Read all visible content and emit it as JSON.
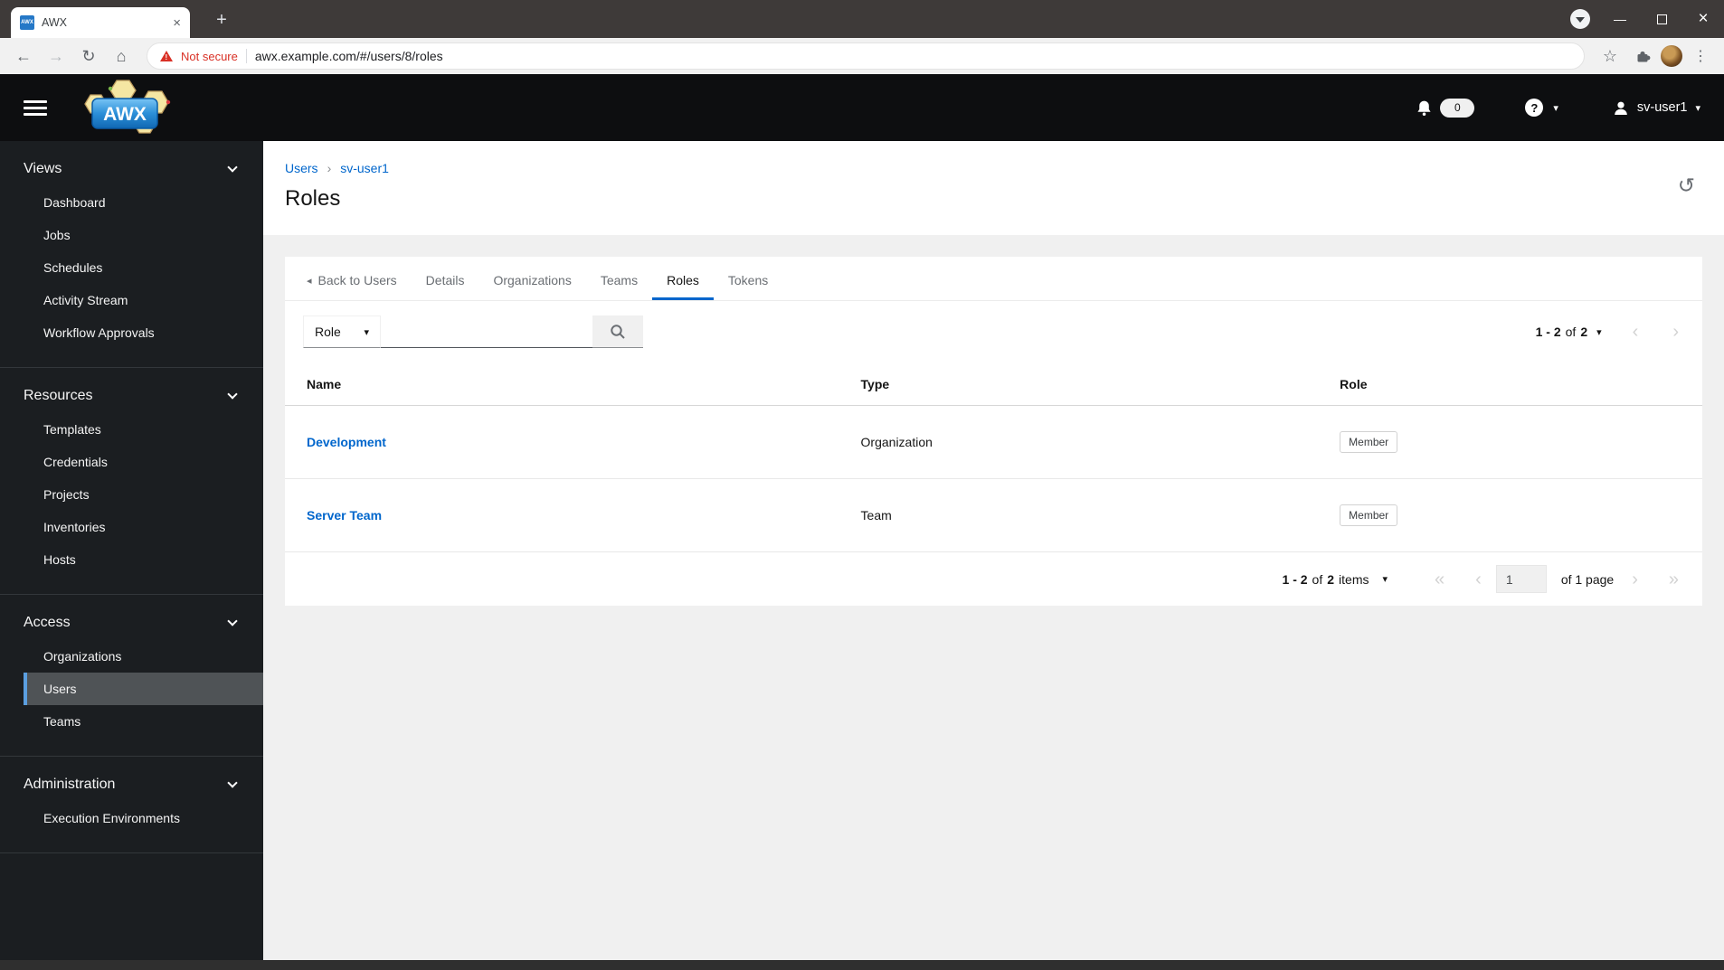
{
  "browser": {
    "tab_title": "AWX",
    "favicon_text": "AWX",
    "url": "awx.example.com/#/users/8/roles",
    "security_warning": "Not secure"
  },
  "app_header": {
    "logo_text": "AWX",
    "notification_count": "0",
    "help_glyph": "?",
    "username": "sv-user1"
  },
  "sidebar": {
    "active_item": "Users",
    "sections": [
      {
        "label": "Views",
        "items": [
          "Dashboard",
          "Jobs",
          "Schedules",
          "Activity Stream",
          "Workflow Approvals"
        ]
      },
      {
        "label": "Resources",
        "items": [
          "Templates",
          "Credentials",
          "Projects",
          "Inventories",
          "Hosts"
        ]
      },
      {
        "label": "Access",
        "items": [
          "Organizations",
          "Users",
          "Teams"
        ]
      },
      {
        "label": "Administration",
        "items": [
          "Execution Environments"
        ]
      }
    ]
  },
  "main": {
    "breadcrumb": {
      "items": [
        "Users",
        "sv-user1"
      ]
    },
    "page_title": "Roles",
    "tabs": {
      "back_label": "Back to Users",
      "labels": [
        "Details",
        "Organizations",
        "Teams",
        "Roles",
        "Tokens"
      ],
      "active": "Roles"
    },
    "filter": {
      "category": "Role"
    },
    "pagination_top": {
      "range": "1 - 2",
      "of_word": "of",
      "total": "2"
    },
    "table": {
      "columns": [
        "Name",
        "Type",
        "Role"
      ],
      "rows": [
        {
          "name": "Development",
          "type": "Organization",
          "role": "Member"
        },
        {
          "name": "Server Team",
          "type": "Team",
          "role": "Member"
        }
      ]
    },
    "pagination_bottom": {
      "range": "1 - 2",
      "of_word": "of",
      "total": "2",
      "items_word": "items",
      "page_value": "1",
      "page_text": "of 1 page"
    }
  },
  "colors": {
    "accent_blue": "#0066cc",
    "nav_active_bar": "#5b9fe0",
    "danger_red": "#d93025"
  },
  "icons": {
    "back_caret": "◂",
    "caret_down": "▾",
    "angle_left": "‹",
    "angle_right": "›",
    "angle_double_left": "«",
    "angle_double_right": "»",
    "history": "↺",
    "star": "☆",
    "dots": "⋮",
    "close": "×",
    "plus": "+",
    "back_arrow": "←",
    "forward_arrow": "→",
    "reload": "↻",
    "home": "⌂",
    "minimize": "—",
    "breadcrumb_sep": "›",
    "warning_mark": "!"
  }
}
